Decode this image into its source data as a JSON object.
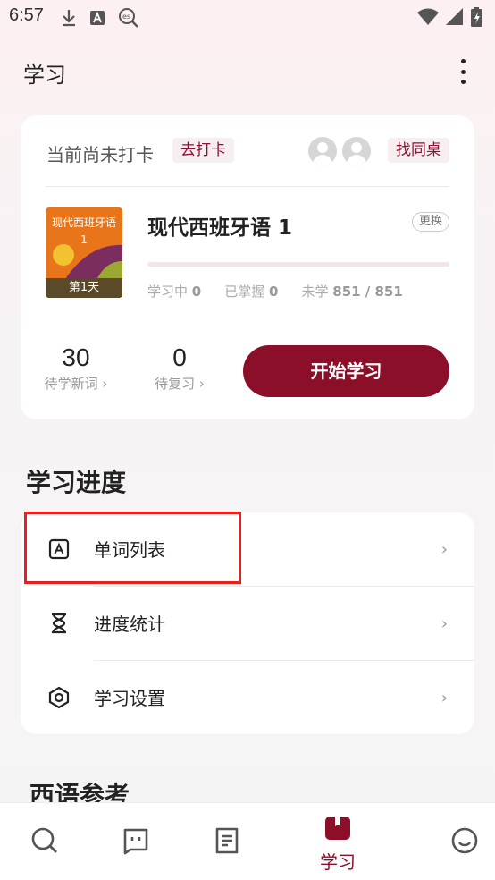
{
  "status_bar": {
    "time": "6:57",
    "icons_left": [
      "download-icon",
      "font-a-icon",
      "search-es-icon"
    ],
    "icons_right": [
      "wifi-icon",
      "signal-icon",
      "battery-charging-icon"
    ]
  },
  "app_bar": {
    "title": "学习",
    "more_icon": "more-vertical-icon"
  },
  "checkin": {
    "status_text": "当前尚未打卡",
    "checkin_button": "去打卡",
    "deskmate_button": "找同桌"
  },
  "book": {
    "cover_title": "现代西班牙语 1",
    "cover_day": "第1天",
    "title": "现代西班牙语 1",
    "change_button": "更换",
    "progress_fraction": 0.0,
    "stats": [
      {
        "label": "学习中",
        "value": "0"
      },
      {
        "label": "已掌握",
        "value": "0"
      },
      {
        "label": "未学",
        "value": "851 / 851"
      }
    ]
  },
  "counts": {
    "new_words": {
      "value": "30",
      "label": "待学新词"
    },
    "review": {
      "value": "0",
      "label": "待复习"
    }
  },
  "start_button": "开始学习",
  "progress_section": {
    "title": "学习进度",
    "items": [
      {
        "label": "单词列表",
        "icon": "word-list-icon"
      },
      {
        "label": "进度统计",
        "icon": "hourglass-icon"
      },
      {
        "label": "学习设置",
        "icon": "settings-hexagon-icon"
      }
    ]
  },
  "reference_section": {
    "title": "西语参考"
  },
  "tab_bar": {
    "tabs": [
      {
        "icon": "search-icon"
      },
      {
        "icon": "chat-box-icon"
      },
      {
        "icon": "document-icon"
      },
      {
        "icon": "book-icon",
        "label": "学习",
        "active": true
      },
      {
        "icon": "smile-icon"
      }
    ]
  },
  "colors": {
    "accent": "#8c0f2a",
    "highlight_border": "#e8201e",
    "tag_background": "#f6eef0"
  }
}
